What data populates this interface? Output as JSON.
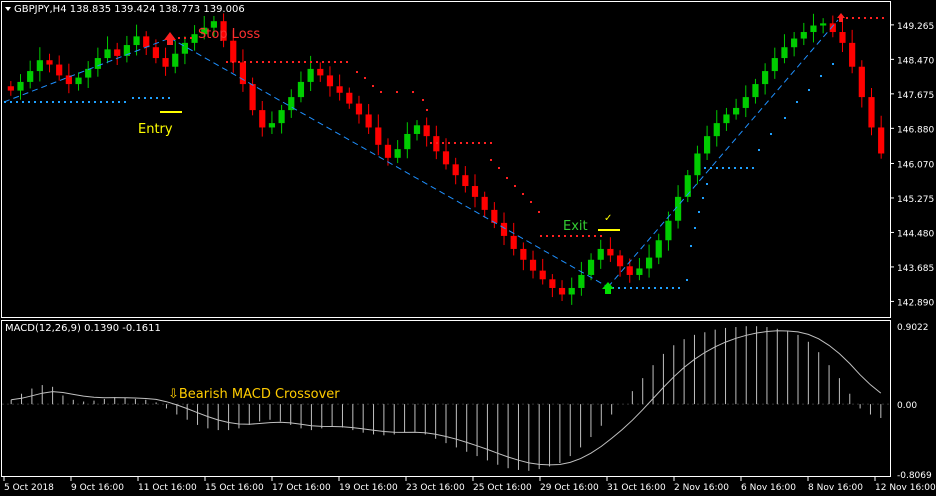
{
  "header": {
    "symbol_line": "GBPJPY,H4  138.835 139.424 138.773 139.006"
  },
  "macd_header": "MACD(12,26,9) 0.1390 -0.1611",
  "annotations": {
    "stop_loss": "Stop Loss",
    "entry": "Entry",
    "exit": "Exit",
    "crossover": "⇩Bearish MACD Crossover"
  },
  "colors": {
    "bull": "#00cc00",
    "bear": "#ff0000",
    "trend_line": "#1e90ff",
    "sar_dots_bear": "#ff2020",
    "sar_dots_bull": "#1ea0ff",
    "macd_hist": "#c0c0c0",
    "macd_signal": "#c0c0c0",
    "grid_text": "#ffffff",
    "stop_loss_text": "#ff3030",
    "entry_text": "#ffff00",
    "exit_text": "#33cc33",
    "crossover_text": "#ffcc00"
  },
  "chart_data": [
    {
      "type": "candlestick",
      "title": "GBPJPY,H4",
      "ylim": [
        142.6,
        149.7
      ],
      "y_ticks": [
        "149.265",
        "148.470",
        "147.675",
        "146.880",
        "146.070",
        "145.275",
        "144.480",
        "143.685",
        "142.890"
      ],
      "y_tick_values": [
        149.265,
        148.47,
        147.675,
        146.88,
        146.07,
        145.275,
        144.48,
        143.685,
        142.89
      ],
      "x_ticks": [
        "5 Oct 2018",
        "9 Oct 16:00",
        "11 Oct 16:00",
        "15 Oct 16:00",
        "17 Oct 16:00",
        "19 Oct 16:00",
        "23 Oct 16:00",
        "25 Oct 16:00",
        "29 Oct 16:00",
        "31 Oct 16:00",
        "2 Nov 16:00",
        "6 Nov 16:00",
        "8 Nov 16:00",
        "12 Nov 16:00"
      ],
      "closes": [
        147.75,
        147.95,
        148.2,
        148.45,
        148.35,
        148.1,
        147.9,
        148.05,
        148.25,
        148.5,
        148.7,
        148.55,
        148.8,
        149.0,
        148.75,
        148.5,
        148.3,
        148.6,
        148.85,
        149.05,
        149.2,
        149.35,
        148.9,
        148.4,
        147.9,
        147.3,
        146.9,
        147.0,
        147.3,
        147.6,
        147.95,
        148.25,
        148.1,
        147.85,
        147.7,
        147.45,
        147.2,
        146.9,
        146.5,
        146.2,
        146.4,
        146.75,
        146.95,
        146.7,
        146.35,
        146.05,
        145.8,
        145.55,
        145.3,
        145.0,
        144.7,
        144.4,
        144.1,
        143.85,
        143.6,
        143.4,
        143.2,
        143.05,
        143.2,
        143.5,
        143.85,
        144.1,
        143.95,
        143.7,
        143.5,
        143.65,
        143.9,
        144.3,
        144.75,
        145.3,
        145.8,
        146.3,
        146.7,
        147.0,
        147.2,
        147.35,
        147.6,
        147.9,
        148.2,
        148.5,
        148.75,
        148.95,
        149.1,
        149.25,
        149.3,
        149.1,
        148.85,
        148.3,
        147.6,
        146.9,
        146.3
      ]
    },
    {
      "type": "bar",
      "title": "MACD(12,26,9) 0.1390 -0.1611",
      "ylim": [
        -0.8069,
        0.9022
      ],
      "y_ticks": [
        "0.9022",
        "0.00",
        "-0.8069"
      ],
      "y_tick_values": [
        0.9022,
        0.0,
        -0.8069
      ],
      "hist_values": [
        0.05,
        0.12,
        0.18,
        0.22,
        0.2,
        0.1,
        0.05,
        0.03,
        0.04,
        0.06,
        0.08,
        0.07,
        0.06,
        0.05,
        0.02,
        -0.05,
        -0.12,
        -0.18,
        -0.24,
        -0.28,
        -0.3,
        -0.3,
        -0.28,
        -0.24,
        -0.2,
        -0.18,
        -0.2,
        -0.24,
        -0.28,
        -0.3,
        -0.28,
        -0.26,
        -0.27,
        -0.3,
        -0.33,
        -0.35,
        -0.36,
        -0.35,
        -0.33,
        -0.32,
        -0.35,
        -0.4,
        -0.45,
        -0.5,
        -0.55,
        -0.6,
        -0.65,
        -0.7,
        -0.74,
        -0.76,
        -0.77,
        -0.75,
        -0.72,
        -0.68,
        -0.6,
        -0.5,
        -0.38,
        -0.25,
        -0.12,
        0.0,
        0.15,
        0.3,
        0.45,
        0.58,
        0.68,
        0.75,
        0.8,
        0.83,
        0.86,
        0.88,
        0.89,
        0.9,
        0.9,
        0.89,
        0.87,
        0.84,
        0.8,
        0.72,
        0.6,
        0.45,
        0.3,
        0.12,
        -0.05,
        -0.12,
        -0.16
      ]
    }
  ]
}
